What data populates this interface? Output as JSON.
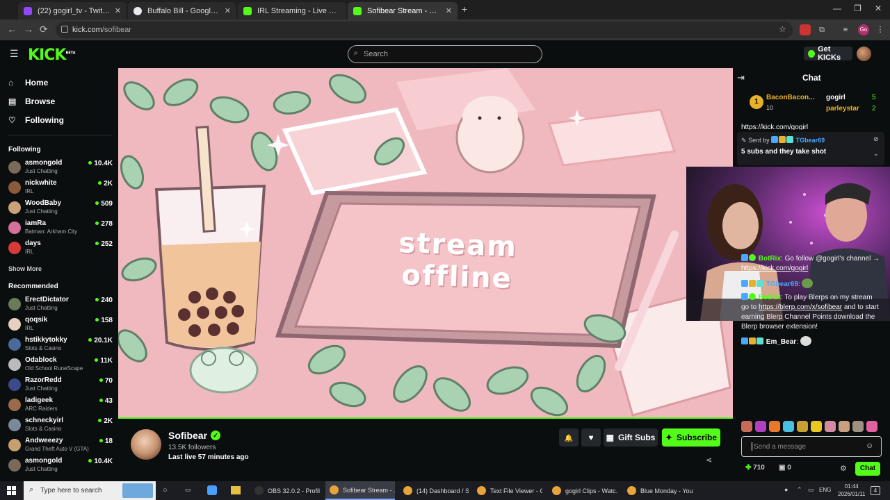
{
  "browser": {
    "tabs": [
      {
        "title": "(22) gogirl_tv - Twitch",
        "color": "#9147ff"
      },
      {
        "title": "Buffalo Bill - Google Search",
        "color": "#e8eaed"
      },
      {
        "title": "IRL Streaming - Live Streams on",
        "color": "#53fc18"
      },
      {
        "title": "Sofibear Stream - Watch Live on",
        "color": "#53fc18"
      }
    ],
    "new_tab": "+",
    "window_controls": {
      "min": "—",
      "max": "❐",
      "close": "✕"
    },
    "nav": {
      "back": "←",
      "forward": "→",
      "reload": "⟳"
    },
    "url_host": "kick.com",
    "url_path": "/sofibear",
    "ext_profile": "Go"
  },
  "kick_header": {
    "logo": "KICK",
    "logo_badge": "BETA",
    "menu_icon": "☰",
    "search_placeholder": "Search",
    "get_kicks": "Get KICKs"
  },
  "sidebar": {
    "nav": [
      {
        "label": "Home",
        "icon": "⌂"
      },
      {
        "label": "Browse",
        "icon": "▤"
      },
      {
        "label": "Following",
        "icon": "♡"
      }
    ],
    "following_header": "Following",
    "following": [
      {
        "name": "asmongold",
        "category": "Just Chatting",
        "viewers": "10.4K",
        "color": "#7a6a5a"
      },
      {
        "name": "nickwhite",
        "category": "IRL",
        "viewers": "2K",
        "color": "#8b5a3c"
      },
      {
        "name": "WoodBaby",
        "category": "Just Chatting",
        "viewers": "509",
        "color": "#c9a27a"
      },
      {
        "name": "iamRa",
        "category": "Batman: Arkham City",
        "viewers": "278",
        "color": "#d4709a"
      },
      {
        "name": "days",
        "category": "IRL",
        "viewers": "252",
        "color": "#d83a3a"
      }
    ],
    "show_more": "Show More",
    "recommended_header": "Recommended",
    "recommended": [
      {
        "name": "ErectDictator",
        "category": "Just Chatting",
        "viewers": "240",
        "color": "#6a7a5a"
      },
      {
        "name": "qoqsik",
        "category": "IRL",
        "viewers": "158",
        "color": "#e8d0c0"
      },
      {
        "name": "hstikkytokky",
        "category": "Slots & Casino",
        "viewers": "20.1K",
        "color": "#4a6a9a"
      },
      {
        "name": "Odablock",
        "category": "Old School RuneScape",
        "viewers": "11K",
        "color": "#bbbbbb"
      },
      {
        "name": "RazorRedd",
        "category": "Just Chatting",
        "viewers": "70",
        "color": "#3a4a8a"
      },
      {
        "name": "ladigeek",
        "category": "ARC Raiders",
        "viewers": "43",
        "color": "#9a6a4a"
      },
      {
        "name": "schneckyirl",
        "category": "Slots & Casino",
        "viewers": "2K",
        "color": "#7a8a9a"
      },
      {
        "name": "Andweeezy",
        "category": "Grand Theft Auto V (GTA)",
        "viewers": "18",
        "color": "#c8a070"
      },
      {
        "name": "asmongold",
        "category": "Just Chatting",
        "viewers": "10.4K",
        "color": "#7a6a5a"
      }
    ]
  },
  "player": {
    "offline_line1": "stream",
    "offline_line2": "offline"
  },
  "channel": {
    "name": "Sofibear",
    "verified_icon": "✓",
    "followers": "13.5K followers",
    "last_live": "Last live 57 minutes ago",
    "bell_icon": "🔔",
    "heart_icon": "♥",
    "gift_subs": "Gift Subs",
    "gift_icon": "▦",
    "subscribe": "Subscribe",
    "star_icon": "✦",
    "share_icon": "⋖"
  },
  "chat": {
    "title": "Chat",
    "collapse_icon": "⇥",
    "leaderboard": [
      {
        "rank": "1",
        "name": "BaconBacon...",
        "count": "10"
      },
      {
        "name": "gogirl",
        "count": "5"
      },
      {
        "name": "parleystar",
        "count": "2"
      }
    ],
    "link_top": "https://kick.com/gogirl",
    "pinned": {
      "sent_by": "Sent by",
      "user": "TGbear69",
      "text": "5 subs and they take shot"
    },
    "messages": [
      {
        "user": "BotRix",
        "text": ": Go follow @gogirl's channel →",
        "link": "https://kick.com/gogirl",
        "user_color": "#53fc18"
      },
      {
        "user": "TGbear69",
        "text": ":",
        "user_color": "#4aa8ff"
      },
      {
        "user": "BotRix",
        "text": ": To play Blerps on my stream go to ",
        "link": "https://blerp.com/x/sofibear",
        "after": " and to start earning Blerp Channel Points download the Blerp browser extension!",
        "user_color": "#53fc18"
      },
      {
        "user": "Em_Bear",
        "text": ":",
        "user_color": "#ffffff"
      }
    ],
    "input_placeholder": "Send a message",
    "points": "710",
    "drops": "0",
    "chat_button": "Chat",
    "gear_icon": "⚙"
  },
  "taskbar": {
    "search_placeholder": "Type here to search",
    "apps": [
      {
        "label": "OBS 32.0.2 - Profile:...",
        "color": "#333333"
      },
      {
        "label": "Sofibear Stream - ...",
        "color": "#e8a33a",
        "active": true
      },
      {
        "label": "(14) Dashboard / St...",
        "color": "#e8a33a"
      },
      {
        "label": "Text File Viewer - G...",
        "color": "#e8a33a"
      },
      {
        "label": "gogirl Clips - Watc...",
        "color": "#e8a33a"
      },
      {
        "label": "Blue Monday - You...",
        "color": "#e8a33a"
      }
    ],
    "lang": "ENG",
    "time": "01:44",
    "date": "2026/01/11",
    "notif": "4"
  },
  "colors": {
    "kick_green": "#53fc18",
    "bg": "#0b0e0f",
    "panel": "#24272c"
  }
}
